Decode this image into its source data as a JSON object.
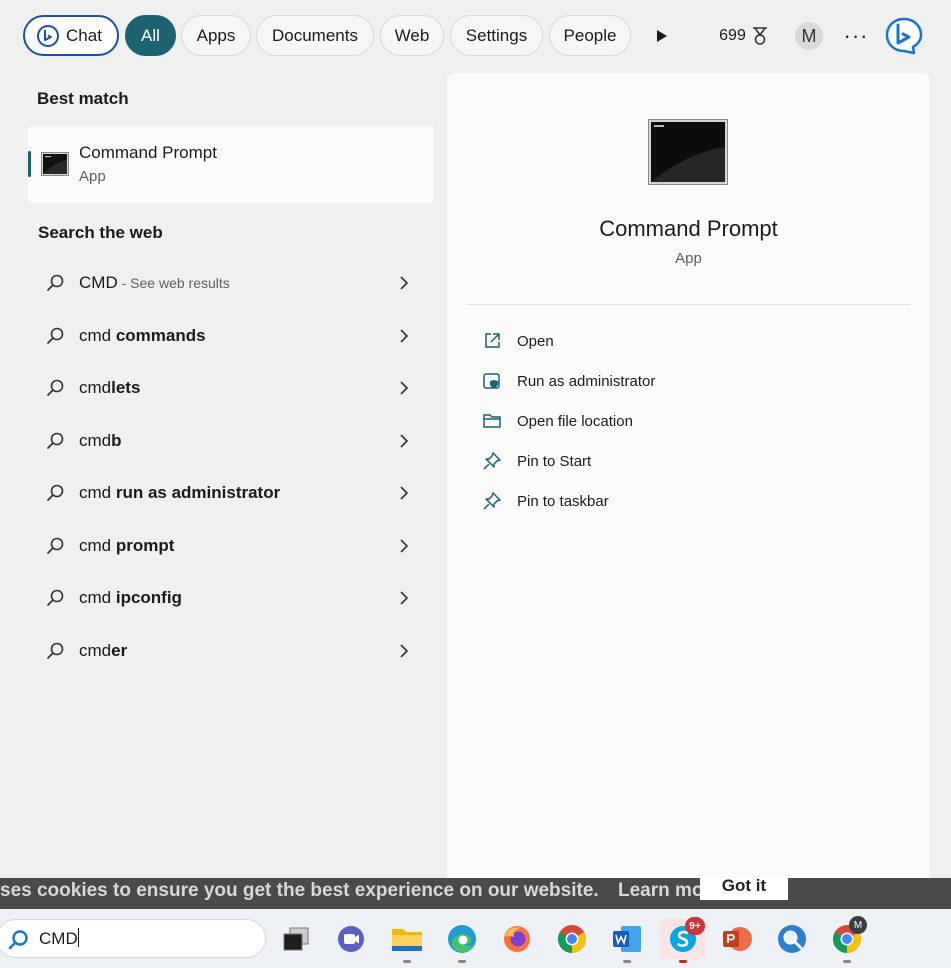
{
  "topbar": {
    "chat_label": "Chat",
    "tabs": [
      "All",
      "Apps",
      "Documents",
      "Web",
      "Settings",
      "People"
    ],
    "points": "699",
    "avatar_initial": "M",
    "more_glyph": "···"
  },
  "best_match": {
    "heading": "Best match",
    "title": "Command Prompt",
    "subtitle": "App"
  },
  "search_web": {
    "heading": "Search the web",
    "items": [
      {
        "prefix": "CMD",
        "bold": "",
        "hint": " - See web results"
      },
      {
        "prefix": "cmd ",
        "bold": "commands",
        "hint": ""
      },
      {
        "prefix": "cmd",
        "bold": "lets",
        "hint": ""
      },
      {
        "prefix": "cmd",
        "bold": "b",
        "hint": ""
      },
      {
        "prefix": "cmd ",
        "bold": "run as administrator",
        "hint": ""
      },
      {
        "prefix": "cmd ",
        "bold": "prompt",
        "hint": ""
      },
      {
        "prefix": "cmd ",
        "bold": "ipconfig",
        "hint": ""
      },
      {
        "prefix": "cmd",
        "bold": "er",
        "hint": ""
      }
    ]
  },
  "detail": {
    "title": "Command Prompt",
    "subtitle": "App",
    "actions": [
      {
        "label": "Open",
        "icon": "open-external-icon"
      },
      {
        "label": "Run as administrator",
        "icon": "admin-shield-icon"
      },
      {
        "label": "Open file location",
        "icon": "folder-icon"
      },
      {
        "label": "Pin to Start",
        "icon": "pin-icon"
      },
      {
        "label": "Pin to taskbar",
        "icon": "pin-icon"
      }
    ]
  },
  "background_page": {
    "cookie_text": "ses cookies to ensure you get the best experience on our website.",
    "cookie_link": "Learn more",
    "cookie_button": "Got it"
  },
  "taskbar": {
    "search_value": "CMD",
    "skype_badge": "9+",
    "chrome_profile_initial": "M"
  },
  "colors": {
    "accent_teal": "#1b6370",
    "chat_border": "#1b4fa8",
    "indicator_active": "#c42b1c"
  }
}
